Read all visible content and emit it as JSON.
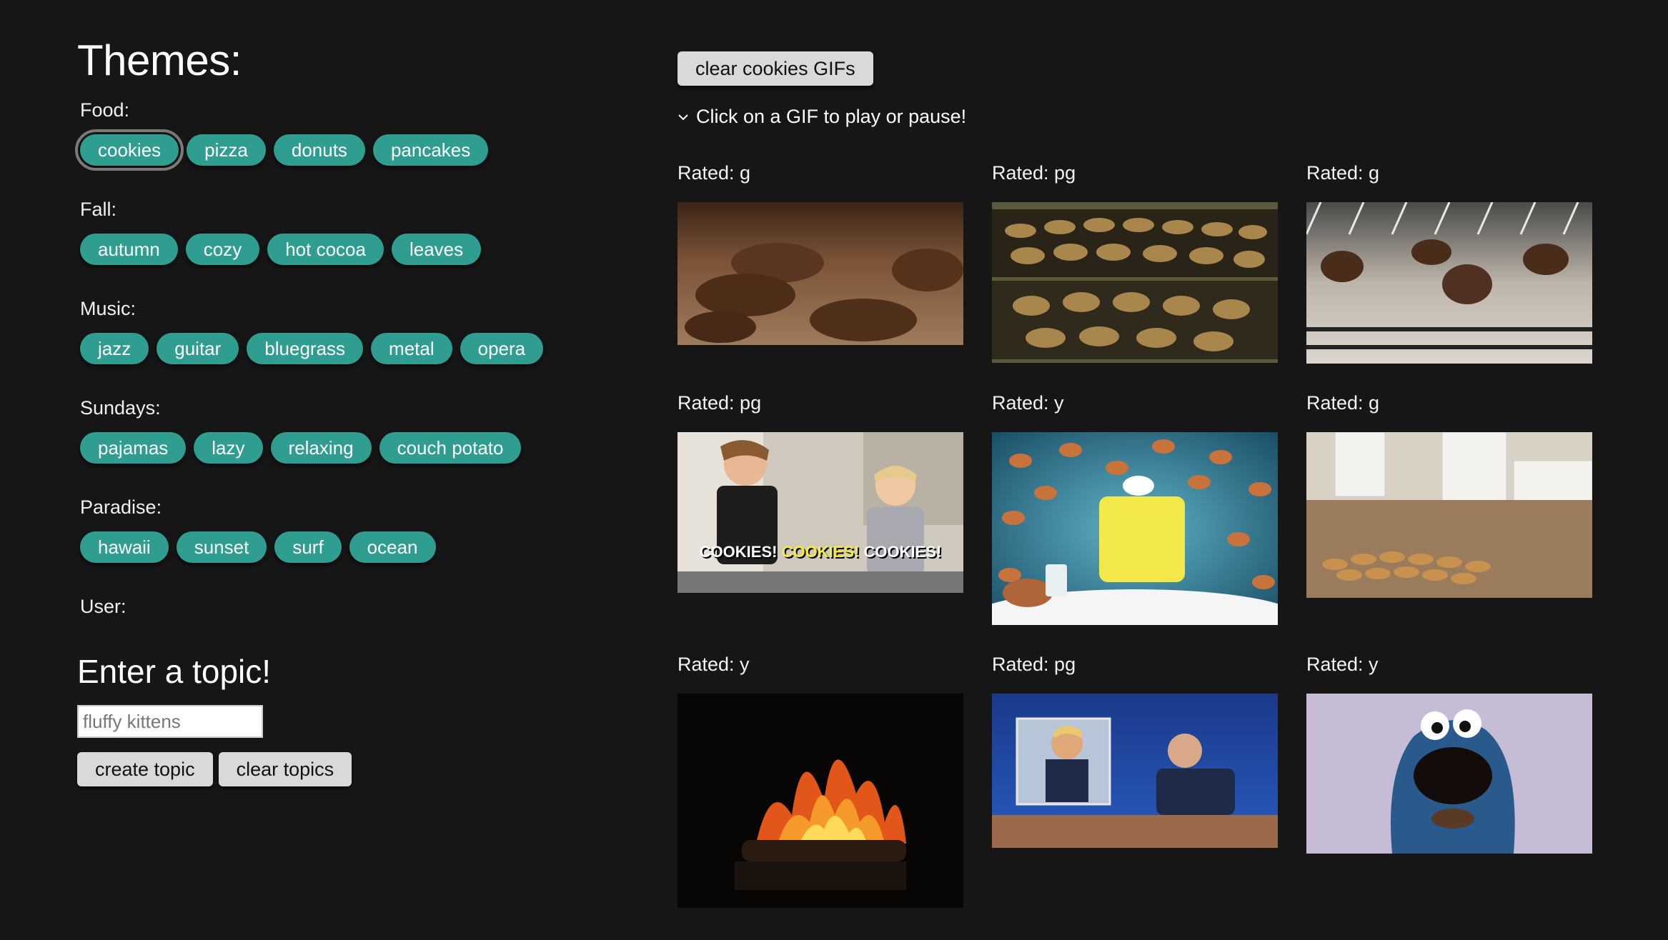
{
  "themes_heading": "Themes:",
  "themes": [
    {
      "label": "Food:",
      "topics": [
        "cookies",
        "pizza",
        "donuts",
        "pancakes"
      ]
    },
    {
      "label": "Fall:",
      "topics": [
        "autumn",
        "cozy",
        "hot cocoa",
        "leaves"
      ]
    },
    {
      "label": "Music:",
      "topics": [
        "jazz",
        "guitar",
        "bluegrass",
        "metal",
        "opera"
      ]
    },
    {
      "label": "Sundays:",
      "topics": [
        "pajamas",
        "lazy",
        "relaxing",
        "couch potato"
      ]
    },
    {
      "label": "Paradise:",
      "topics": [
        "hawaii",
        "sunset",
        "surf",
        "ocean"
      ]
    }
  ],
  "active_topic": "cookies",
  "user_label": "User:",
  "enter_heading": "Enter a topic!",
  "topic_input": {
    "placeholder": "fluffy kittens",
    "value": ""
  },
  "create_button": "create topic",
  "clear_topics_button": "clear topics",
  "clear_gifs_button": "clear cookies GIFs",
  "hint": "Click on a GIF to play or pause!",
  "accent_color": "#2f9e91",
  "gifs": [
    {
      "rating": "Rated: g",
      "scene": "cookies-baking-tray"
    },
    {
      "rating": "Rated: pg",
      "scene": "oven-racks-cookies"
    },
    {
      "rating": "Rated: g",
      "scene": "oven-cookie-dough"
    },
    {
      "rating": "Rated: pg",
      "scene": "kids-dancing",
      "caption_parts": [
        "COOKIES!",
        "COOKIES!",
        "COOKIES!"
      ]
    },
    {
      "rating": "Rated: y",
      "scene": "spongebob-cookies"
    },
    {
      "rating": "Rated: g",
      "scene": "kitchen-cookies"
    },
    {
      "rating": "Rated: y",
      "scene": "fireplace"
    },
    {
      "rating": "Rated: pg",
      "scene": "talk-show"
    },
    {
      "rating": "Rated: y",
      "scene": "cookie-monster"
    }
  ]
}
